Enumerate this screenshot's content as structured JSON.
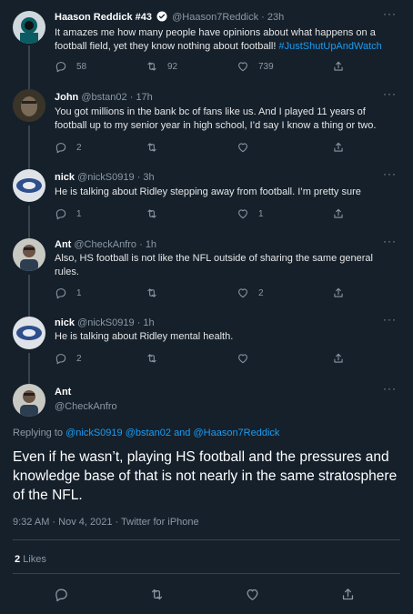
{
  "tweets": [
    {
      "name": "Haason Reddick #43",
      "handle": "@Haason7Reddick",
      "time": "· 23h",
      "verified": true,
      "text": "It amazes me how many people have opinions about what happens on a football field, yet they know nothing about football!",
      "hashtag": "#JustShutUpAndWatch",
      "replies": "58",
      "retweets": "92",
      "likes": "739"
    },
    {
      "name": "John",
      "handle": "@bstan02",
      "time": "· 17h",
      "text": "You got millions in the bank bc of fans like us. And I played 11 years of football up to my senior year in high school, I’d say I know a thing or two.",
      "replies": "2",
      "retweets": "",
      "likes": ""
    },
    {
      "name": "nick",
      "handle": "@nickS0919",
      "time": "· 3h",
      "text": "He is talking about Ridley stepping away from football. I’m pretty sure",
      "replies": "1",
      "retweets": "",
      "likes": "1"
    },
    {
      "name": "Ant",
      "handle": "@CheckAnfro",
      "time": "· 1h",
      "text": "Also, HS football is not like the NFL outside of sharing the same general rules.",
      "replies": "1",
      "retweets": "",
      "likes": "2"
    },
    {
      "name": "nick",
      "handle": "@nickS0919",
      "time": "· 1h",
      "text": "He is talking about Ridley mental health.",
      "replies": "2",
      "retweets": "",
      "likes": ""
    }
  ],
  "main": {
    "name": "Ant",
    "handle": "@CheckAnfro",
    "replying_prefix": "Replying to",
    "replying_to": "@nickS0919 @bstan02 and @Haason7Reddick",
    "text": "Even if he wasn’t, playing HS football and the pressures and knowledge base of that is not nearly in the same stratosphere of the NFL.",
    "timestamp": "9:32 AM · Nov 4, 2021 · Twitter for iPhone",
    "likes_count": "2",
    "likes_label": "Likes"
  },
  "colors": {
    "background": "#15202b",
    "accent": "#1d9bf0",
    "muted": "#8b98a5",
    "divider": "#38444d"
  },
  "icons": [
    "reply-icon",
    "retweet-icon",
    "like-icon",
    "share-icon",
    "more-icon",
    "verified-icon"
  ]
}
